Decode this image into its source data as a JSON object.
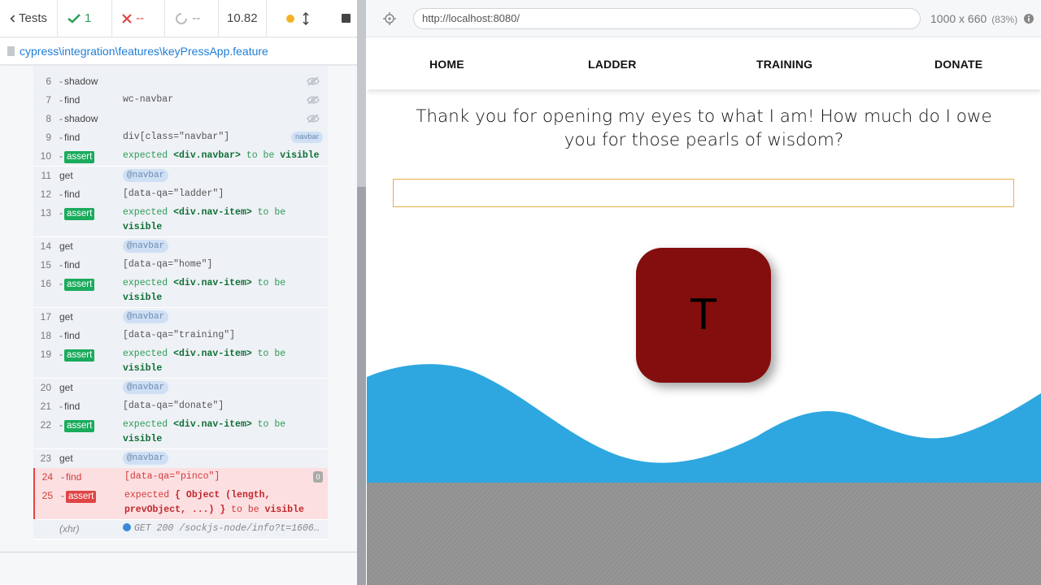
{
  "reporter": {
    "tests_label": "Tests",
    "passed_count": "1",
    "failed_count": "--",
    "pending_count": "--",
    "duration": "10.82",
    "spec_path": "cypress\\integration\\features\\keyPressApp.feature"
  },
  "commands": [
    {
      "num": "6",
      "name": "shadow",
      "msg": "",
      "sub": true,
      "icon": "eye-off"
    },
    {
      "num": "7",
      "name": "find",
      "msg": "wc-navbar",
      "sub": true,
      "icon": "eye-off"
    },
    {
      "num": "8",
      "name": "shadow",
      "msg": "",
      "sub": true,
      "icon": "eye-off"
    },
    {
      "num": "9",
      "name": "find",
      "msg": "div[class=\"navbar\"]",
      "sub": true,
      "tag": "navbar"
    },
    {
      "num": "10",
      "name": "assert",
      "msg_pre": "expected ",
      "msg_b1": "<div.navbar>",
      "msg_mid": " to be ",
      "msg_b2": "visible",
      "sub": true
    },
    {
      "num": "11",
      "name": "get",
      "alias": "@navbar"
    },
    {
      "num": "12",
      "name": "find",
      "msg": "[data-qa=\"ladder\"]",
      "sub": true
    },
    {
      "num": "13",
      "name": "assert",
      "msg_pre": "expected ",
      "msg_b1": "<div.nav-item>",
      "msg_mid": " to be ",
      "msg_b2": "visible",
      "sub": true
    },
    {
      "num": "14",
      "name": "get",
      "alias": "@navbar"
    },
    {
      "num": "15",
      "name": "find",
      "msg": "[data-qa=\"home\"]",
      "sub": true
    },
    {
      "num": "16",
      "name": "assert",
      "msg_pre": "expected ",
      "msg_b1": "<div.nav-item>",
      "msg_mid": " to be ",
      "msg_b2": "visible",
      "sub": true
    },
    {
      "num": "17",
      "name": "get",
      "alias": "@navbar"
    },
    {
      "num": "18",
      "name": "find",
      "msg": "[data-qa=\"training\"]",
      "sub": true
    },
    {
      "num": "19",
      "name": "assert",
      "msg_pre": "expected ",
      "msg_b1": "<div.nav-item>",
      "msg_mid": " to be ",
      "msg_b2": "visible",
      "sub": true
    },
    {
      "num": "20",
      "name": "get",
      "alias": "@navbar"
    },
    {
      "num": "21",
      "name": "find",
      "msg": "[data-qa=\"donate\"]",
      "sub": true
    },
    {
      "num": "22",
      "name": "assert",
      "msg_pre": "expected ",
      "msg_b1": "<div.nav-item>",
      "msg_mid": " to be ",
      "msg_b2": "visible",
      "sub": true
    },
    {
      "num": "23",
      "name": "get",
      "alias": "@navbar"
    },
    {
      "num": "24",
      "name": "find",
      "msg": "[data-qa=\"pinco\"]",
      "sub": true,
      "failed": true,
      "count": "0"
    },
    {
      "num": "25",
      "name": "assert",
      "msg_pre": "expected ",
      "msg_b1": "{ Object (length, prevObject, ...) }",
      "msg_mid": " to be ",
      "msg_b2": "visible",
      "sub": true,
      "failed": true
    }
  ],
  "xhr": {
    "name": "(xhr)",
    "msg": "GET 200 /sockjs-node/info?t=160619…"
  },
  "aut_header": {
    "url": "http://localhost:8080/",
    "viewport": "1000 x 660",
    "scale": "(83%)"
  },
  "app": {
    "nav": {
      "home": "HOME",
      "ladder": "LADDER",
      "training": "TRAINING",
      "donate": "DONATE"
    },
    "quote": "Thank you for opening my eyes to what I am! How much do I owe you for those pearls of wisdom?",
    "input_value": "",
    "key_letter": "T",
    "colors": {
      "key_bg": "#840E0E",
      "wave": "#2EA7E0",
      "input_border": "#E8B04A"
    }
  }
}
